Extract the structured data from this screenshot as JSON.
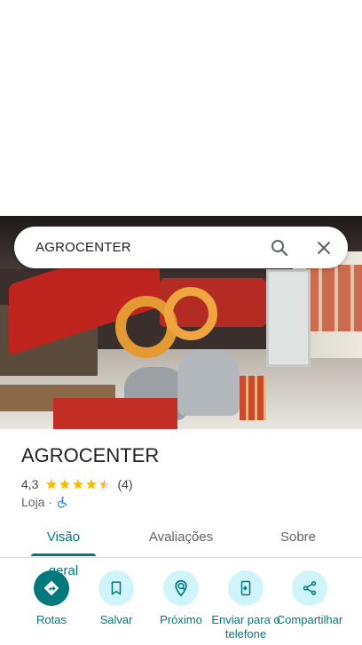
{
  "search": {
    "query": "AGROCENTER"
  },
  "place": {
    "title": "AGROCENTER",
    "rating": "4,3",
    "stars": 4.3,
    "review_count": "(4)",
    "category": "Loja",
    "separator": "·"
  },
  "tabs": [
    {
      "label": "Visão geral",
      "active": true
    },
    {
      "label": "Avaliações",
      "active": false
    },
    {
      "label": "Sobre",
      "active": false
    }
  ],
  "actions": [
    {
      "label": "Rotas",
      "icon": "directions-icon"
    },
    {
      "label": "Salvar",
      "icon": "bookmark-icon"
    },
    {
      "label": "Próximo",
      "icon": "nearby-icon"
    },
    {
      "label": "Enviar para o telefone",
      "icon": "send-to-phone-icon"
    },
    {
      "label": "Compartilhar",
      "icon": "share-icon"
    }
  ],
  "colors": {
    "accent": "#00787c",
    "action_bg": "#cff4fb",
    "star": "#fbbc04"
  }
}
